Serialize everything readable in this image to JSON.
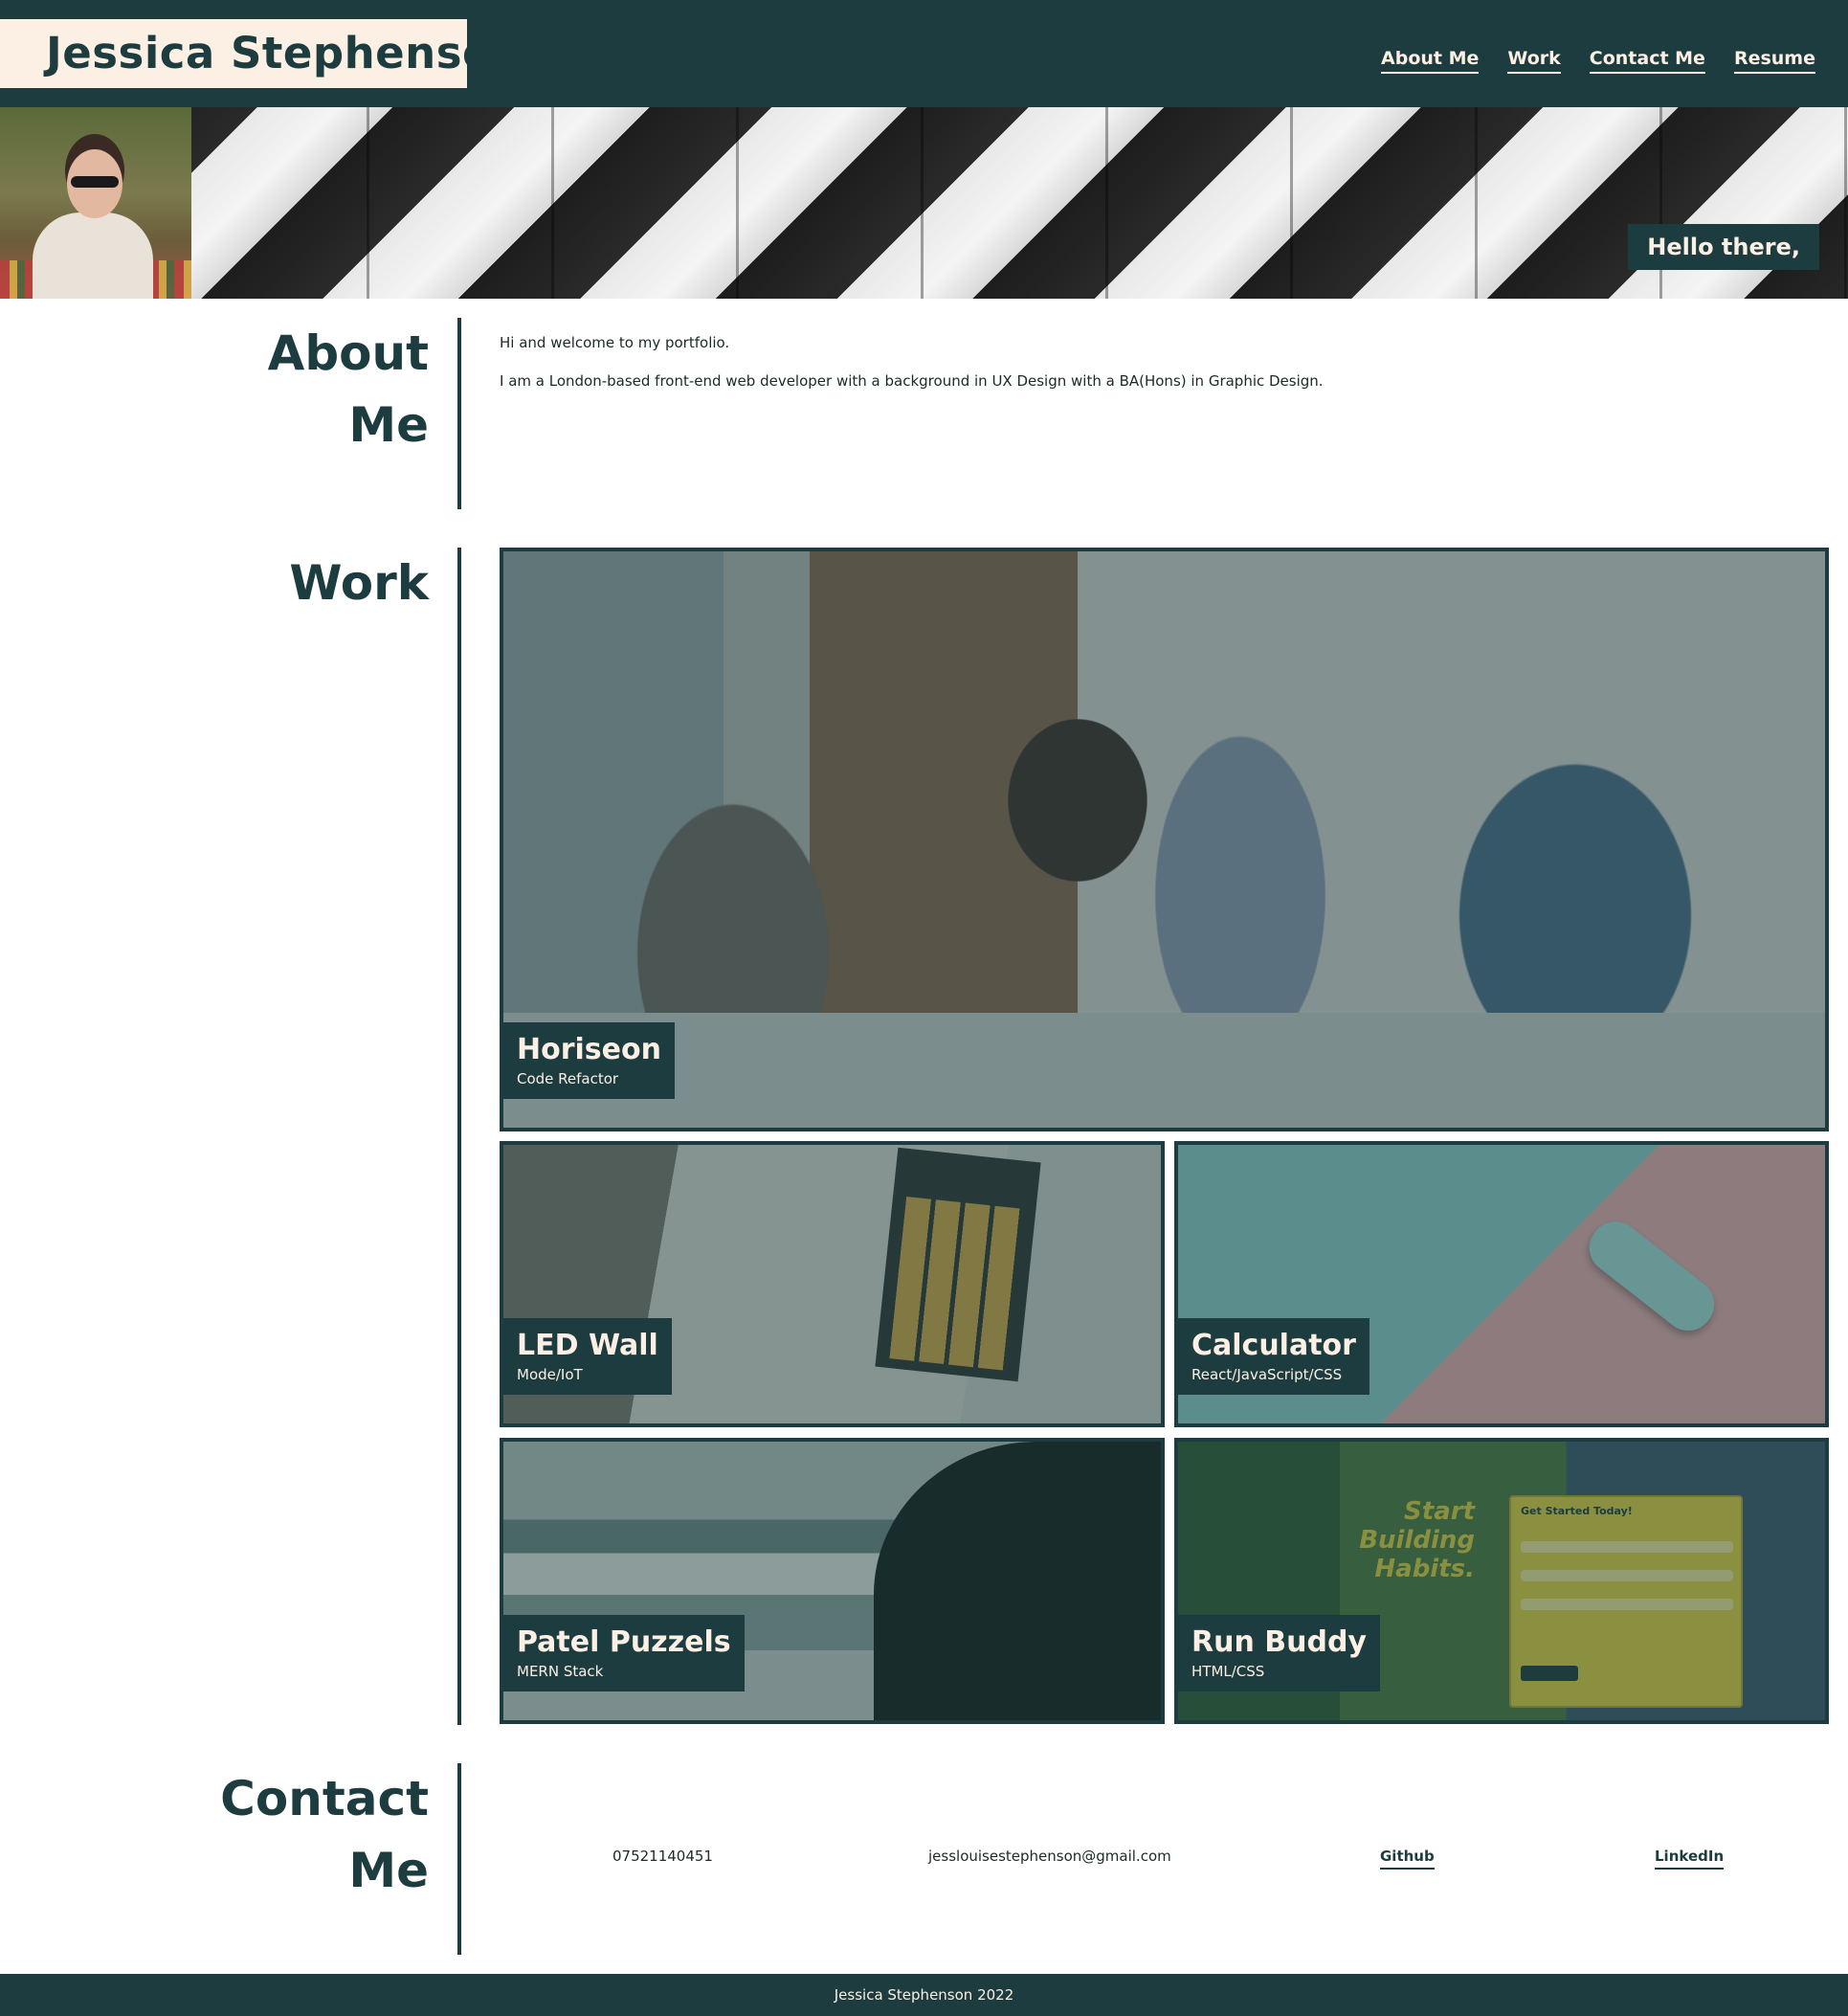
{
  "header": {
    "brand": "Jessica Stephenson",
    "nav": [
      {
        "label": "About Me"
      },
      {
        "label": "Work"
      },
      {
        "label": "Contact Me"
      },
      {
        "label": "Resume"
      }
    ]
  },
  "hero": {
    "greeting": "Hello there,"
  },
  "about": {
    "title_line1": "About",
    "title_line2": "Me",
    "paragraphs": [
      "Hi and welcome to my portfolio.",
      "I am a London-based front-end web developer with a background in UX Design with a BA(Hons) in Graphic Design."
    ]
  },
  "work": {
    "title": "Work",
    "projects": [
      {
        "name": "Horiseon",
        "tech": "Code Refactor"
      },
      {
        "name": "LED Wall",
        "tech": "Mode/IoT"
      },
      {
        "name": "Calculator",
        "tech": "React/JavaScript/CSS"
      },
      {
        "name": "Patel Puzzels",
        "tech": "MERN Stack"
      },
      {
        "name": "Run Buddy",
        "tech": "HTML/CSS"
      }
    ],
    "run_buddy_screenshot": {
      "heading_line1": "Start Building",
      "heading_line2": "Habits.",
      "form_title": "Get Started Today!"
    }
  },
  "contact": {
    "title_line1": "Contact",
    "title_line2": "Me",
    "phone": "07521140451",
    "email": "jesslouisestephenson@gmail.com",
    "github": "Github",
    "linkedin": "LinkedIn"
  },
  "footer": {
    "text": "Jessica Stephenson 2022"
  },
  "colors": {
    "primary": "#1d3c3f",
    "cream": "#fcefe3"
  }
}
